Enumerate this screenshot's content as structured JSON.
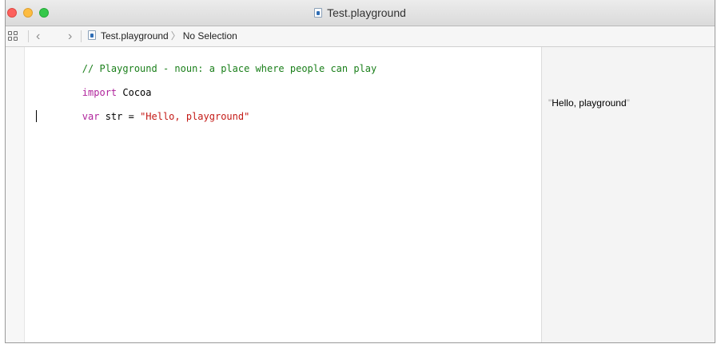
{
  "window": {
    "title": "Test.playground"
  },
  "jumpbar": {
    "file_name": "Test.playground",
    "selection": "No Selection",
    "back_glyph": "‹",
    "forward_glyph": "›",
    "chevron_glyph": "〉"
  },
  "editor": {
    "lines": [
      {
        "comment": "// Playground - noun: a place where people can play"
      },
      {
        "keyword": "import",
        "text": " Cocoa"
      },
      {
        "keyword": "var",
        "text": " str = ",
        "string": "\"Hello, playground\""
      }
    ]
  },
  "results": {
    "quote": "\"",
    "value": "Hello, playground"
  },
  "colors": {
    "comment": "#1a7f1a",
    "keyword": "#b0249c",
    "string": "#c41a16",
    "close": "#fc605c",
    "minimize": "#fdbc40",
    "zoom": "#34c84a"
  },
  "icons": [
    "close-button",
    "minimize-button",
    "zoom-button",
    "playground-file-icon",
    "grid-icon",
    "back-icon",
    "forward-icon"
  ]
}
